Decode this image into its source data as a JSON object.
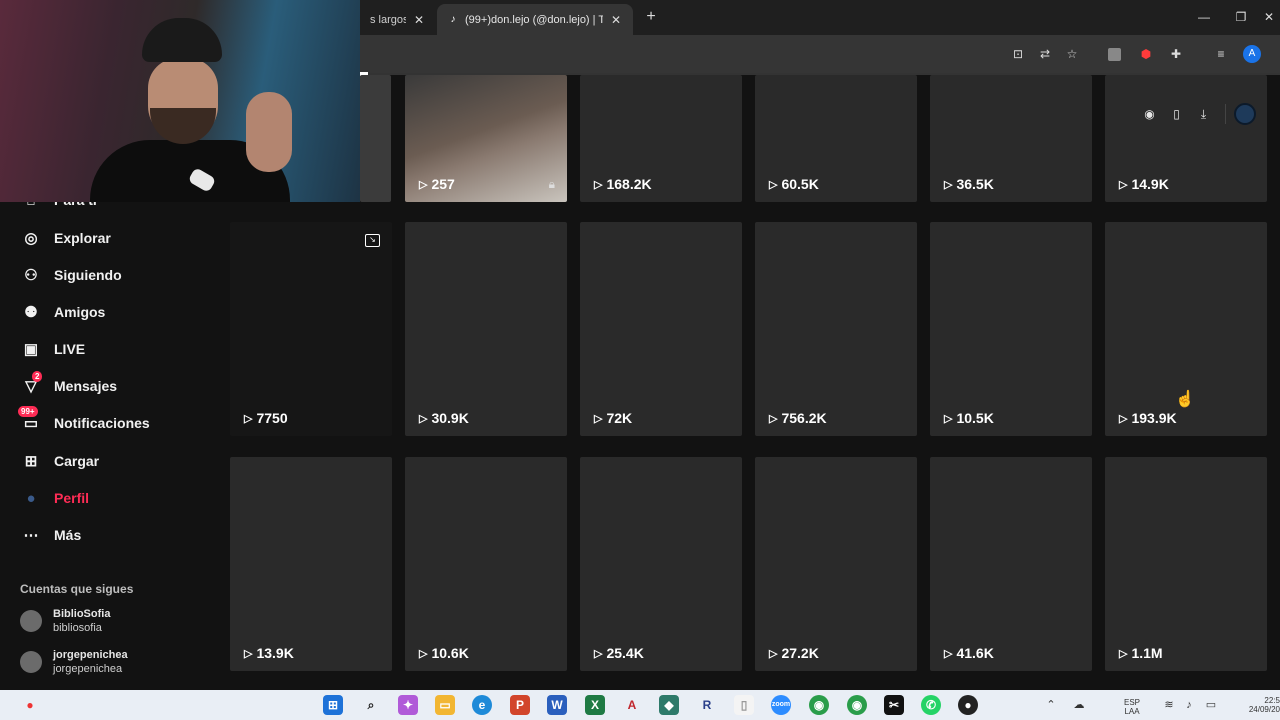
{
  "browser": {
    "tabs": [
      {
        "title": "s largos",
        "active": false
      },
      {
        "title": "(99+)don.lejo (@don.lejo) | TikT",
        "active": true
      }
    ],
    "new_tab": "+",
    "profile_initial": "A",
    "window_controls": {
      "minimize": "—",
      "restore": "❐",
      "close": "✕"
    }
  },
  "sidebar": {
    "partial_item": "Para ti",
    "items": [
      {
        "label": "Explorar",
        "icon": "compass-icon"
      },
      {
        "label": "Siguiendo",
        "icon": "following-icon"
      },
      {
        "label": "Amigos",
        "icon": "friends-icon"
      },
      {
        "label": "LIVE",
        "icon": "live-tv-icon"
      },
      {
        "label": "Mensajes",
        "icon": "messages-icon",
        "badge": "2"
      },
      {
        "label": "Notificaciones",
        "icon": "notifications-icon",
        "badge": "99+"
      },
      {
        "label": "Cargar",
        "icon": "upload-icon"
      },
      {
        "label": "Perfil",
        "icon": "profile-icon",
        "active": true
      },
      {
        "label": "Más",
        "icon": "more-icon"
      }
    ],
    "following_title": "Cuentas que sigues",
    "accounts": [
      {
        "name": "BiblioSofia",
        "username": "bibliosofia"
      },
      {
        "name": "jorgepenichea",
        "username": "jorgepenichea"
      }
    ]
  },
  "videos": {
    "row1": [
      {
        "views": "257",
        "locked": true
      },
      {
        "views": "168.2K"
      },
      {
        "views": "60.5K"
      },
      {
        "views": "36.5K"
      },
      {
        "views": "14.9K"
      }
    ],
    "row2": [
      {
        "views": "7750"
      },
      {
        "views": "30.9K"
      },
      {
        "views": "72K"
      },
      {
        "views": "756.2K"
      },
      {
        "views": "10.5K"
      },
      {
        "views": "193.9K"
      }
    ],
    "row3": [
      {
        "views": "13.9K"
      },
      {
        "views": "10.6K"
      },
      {
        "views": "25.4K"
      },
      {
        "views": "27.2K"
      },
      {
        "views": "41.6K"
      },
      {
        "views": "1.1M"
      }
    ]
  },
  "taskbar": {
    "lang_top": "ESP",
    "lang_bottom": "LAA",
    "time": "22:5",
    "date": "24/09/20"
  },
  "colors": {
    "accent": "#fe2c55",
    "background": "#121212",
    "tile": "#2a2a2a"
  }
}
